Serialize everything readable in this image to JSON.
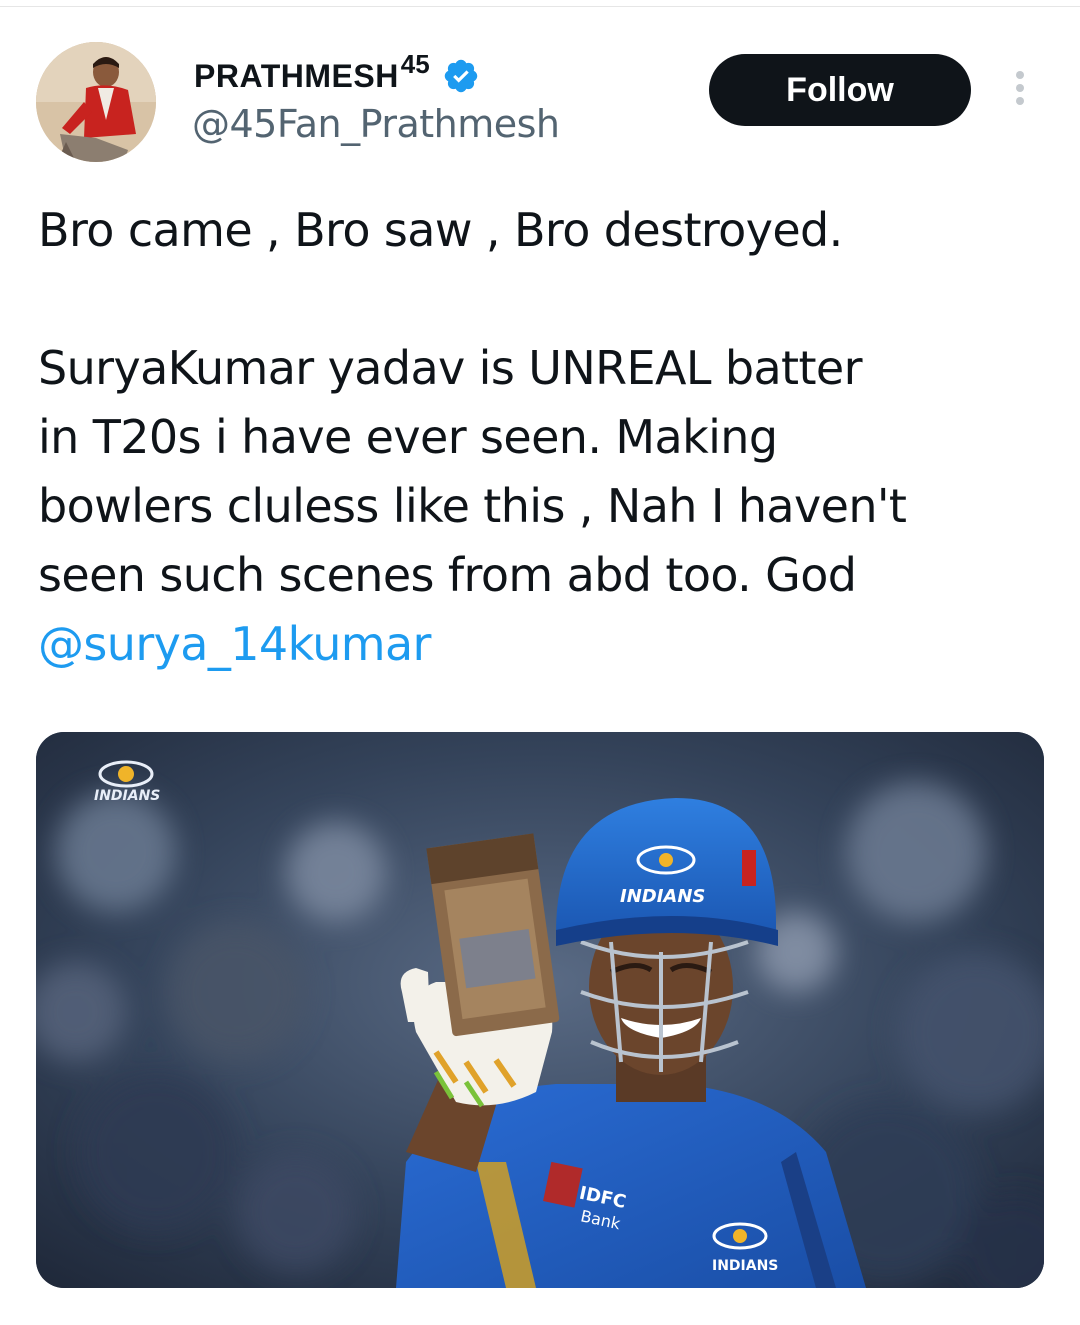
{
  "tweet": {
    "author": {
      "display_name": "PRATHMESH",
      "display_name_suffix": "45",
      "handle": "@45Fan_Prathmesh",
      "verified": true,
      "avatar_icon": "profile-photo"
    },
    "follow_label": "Follow",
    "more_icon": "more-vertical-icon",
    "text": {
      "line1": "Bro came , Bro saw , Bro destroyed.",
      "line2": "SuryaKumar yadav is UNREAL batter",
      "line3": "in T20s i have ever seen. Making",
      "line4": "bowlers cluless like this , Nah I haven't",
      "line5": "seen such scenes from abd too. God",
      "mention": "@surya_14kumar"
    },
    "media": {
      "type": "photo",
      "watermark_logo": "Mumbai Indians logo",
      "helmet_text": "INDIANS",
      "jersey_text": "IDFC Bank",
      "jersey_badge": "INDIANS"
    }
  },
  "colors": {
    "text_primary": "#0f1419",
    "text_secondary": "#536471",
    "link": "#1d9bf0",
    "verified": "#1d9bf0",
    "follow_bg": "#0f1419",
    "follow_text": "#ffffff",
    "mi_blue": "#1f5bbf"
  }
}
